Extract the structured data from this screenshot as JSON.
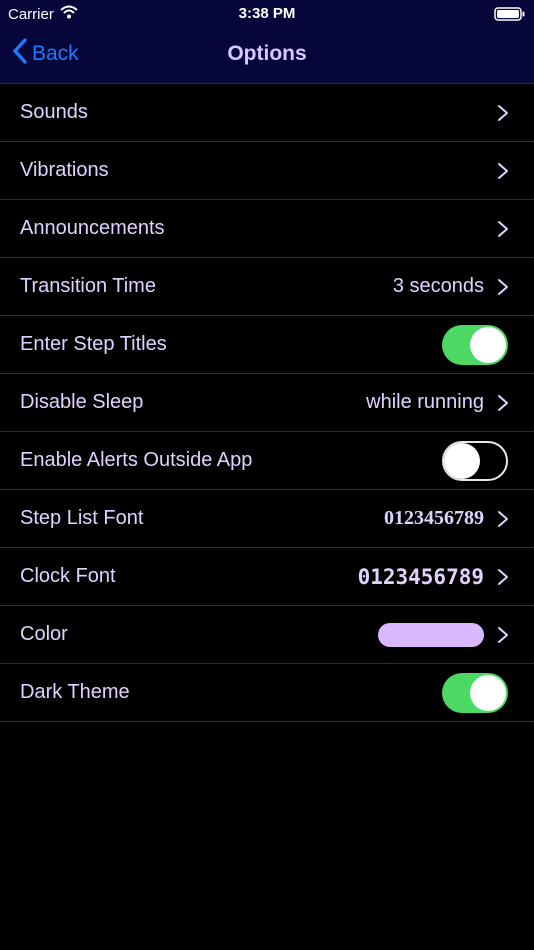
{
  "status_bar": {
    "carrier": "Carrier",
    "time": "3:38 PM",
    "wifi_icon": "wifi-icon",
    "battery_icon": "battery-icon"
  },
  "nav": {
    "back_label": "Back",
    "title": "Options",
    "back_icon": "chevron-left-icon"
  },
  "options": [
    {
      "label": "Sounds",
      "value": "",
      "kind": "disclosure"
    },
    {
      "label": "Vibrations",
      "value": "",
      "kind": "disclosure"
    },
    {
      "label": "Announcements",
      "value": "",
      "kind": "disclosure"
    },
    {
      "label": "Transition Time",
      "value": "3 seconds",
      "kind": "disclosure"
    },
    {
      "label": "Enter Step Titles",
      "value": "on",
      "kind": "toggle"
    },
    {
      "label": "Disable Sleep",
      "value": "while running",
      "kind": "disclosure"
    },
    {
      "label": "Enable Alerts Outside App",
      "value": "off",
      "kind": "toggle"
    },
    {
      "label": "Step List Font",
      "value": "0123456789",
      "kind": "disclosure"
    },
    {
      "label": "Clock Font",
      "value": "0123456789",
      "kind": "disclosure"
    },
    {
      "label": "Color",
      "value": "#d9b8ff",
      "kind": "color"
    },
    {
      "label": "Dark Theme",
      "value": "on",
      "kind": "toggle"
    }
  ],
  "colors": {
    "nav_background": "#06063a",
    "back_blue": "#1e7bff",
    "label_text": "#e0d2ff",
    "toggle_on": "#4cd964",
    "swatch": "#d9b8ff"
  }
}
